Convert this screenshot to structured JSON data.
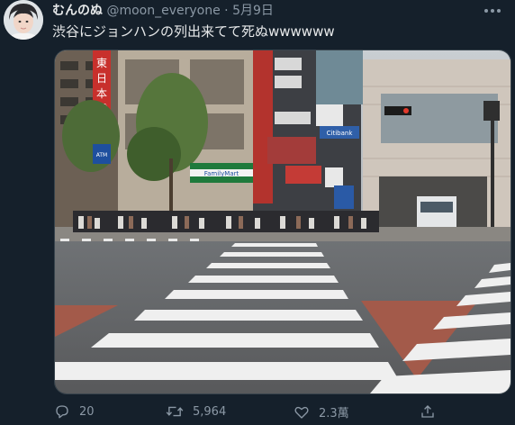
{
  "tweet": {
    "display_name": "むんのぬ",
    "handle": "@moon_everyone",
    "separator": "·",
    "date": "5月9日",
    "text": "渋谷にジョンハンの列出来てて死ぬwwwwww"
  },
  "media": {
    "signs": {
      "vertical_shop": "東日本橋",
      "familymart": "FamilyMart",
      "citibank": "Citibank",
      "atm": "ATM"
    }
  },
  "actions": {
    "reply": {
      "icon": "reply-icon",
      "count": "20"
    },
    "retweet": {
      "icon": "retweet-icon",
      "count": "5,964"
    },
    "like": {
      "icon": "heart-icon",
      "count": "2.3萬"
    },
    "share": {
      "icon": "share-icon"
    }
  },
  "colors": {
    "background": "#15202b",
    "secondary_text": "#8b98a5",
    "primary_text": "#e7e9ea",
    "border": "#38444d"
  }
}
